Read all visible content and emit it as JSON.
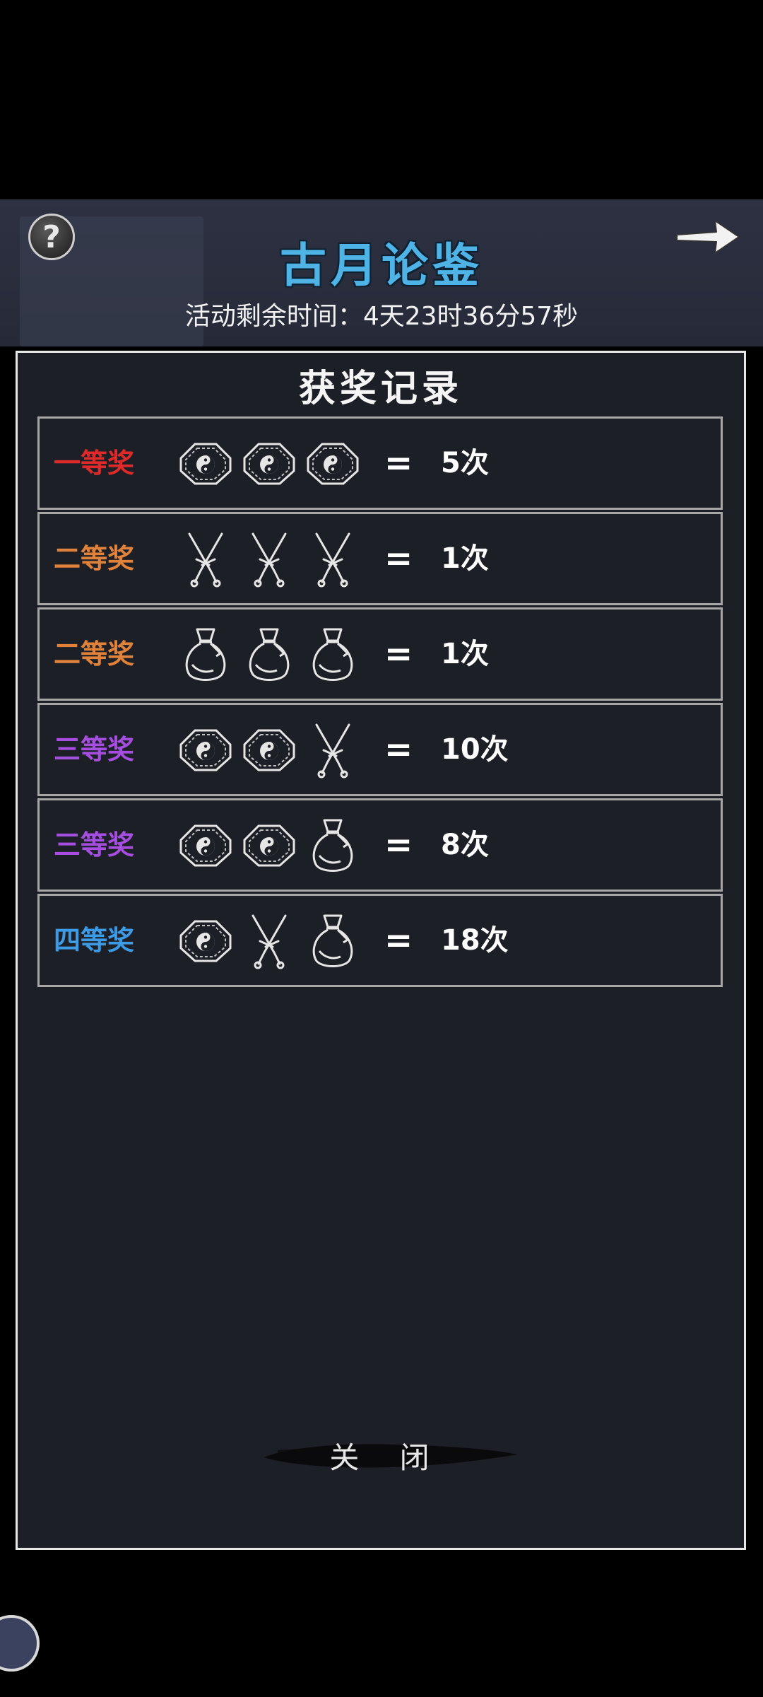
{
  "header": {
    "title": "古月论鉴",
    "timer_label": "活动剩余时间：",
    "timer_value": "4天23时36分57秒",
    "help_symbol": "?"
  },
  "panel": {
    "title": "获奖记录",
    "close_label": "关 闭"
  },
  "rows": [
    {
      "prize": "一等奖",
      "color": "#e02a2a",
      "icons": [
        "bagua-icon",
        "bagua-icon",
        "bagua-icon"
      ],
      "equals": "=",
      "count": "5次"
    },
    {
      "prize": "二等奖",
      "color": "#e0823a",
      "icons": [
        "crossed-swords-icon",
        "crossed-swords-icon",
        "crossed-swords-icon"
      ],
      "equals": "=",
      "count": "1次"
    },
    {
      "prize": "二等奖",
      "color": "#e0823a",
      "icons": [
        "pouch-icon",
        "pouch-icon",
        "pouch-icon"
      ],
      "equals": "=",
      "count": "1次"
    },
    {
      "prize": "三等奖",
      "color": "#a64ee0",
      "icons": [
        "bagua-icon",
        "bagua-icon",
        "crossed-swords-icon"
      ],
      "equals": "=",
      "count": "10次"
    },
    {
      "prize": "三等奖",
      "color": "#a64ee0",
      "icons": [
        "bagua-icon",
        "bagua-icon",
        "pouch-icon"
      ],
      "equals": "=",
      "count": "8次"
    },
    {
      "prize": "四等奖",
      "color": "#3d9be6",
      "icons": [
        "bagua-icon",
        "crossed-swords-icon",
        "pouch-icon"
      ],
      "equals": "=",
      "count": "18次"
    }
  ]
}
